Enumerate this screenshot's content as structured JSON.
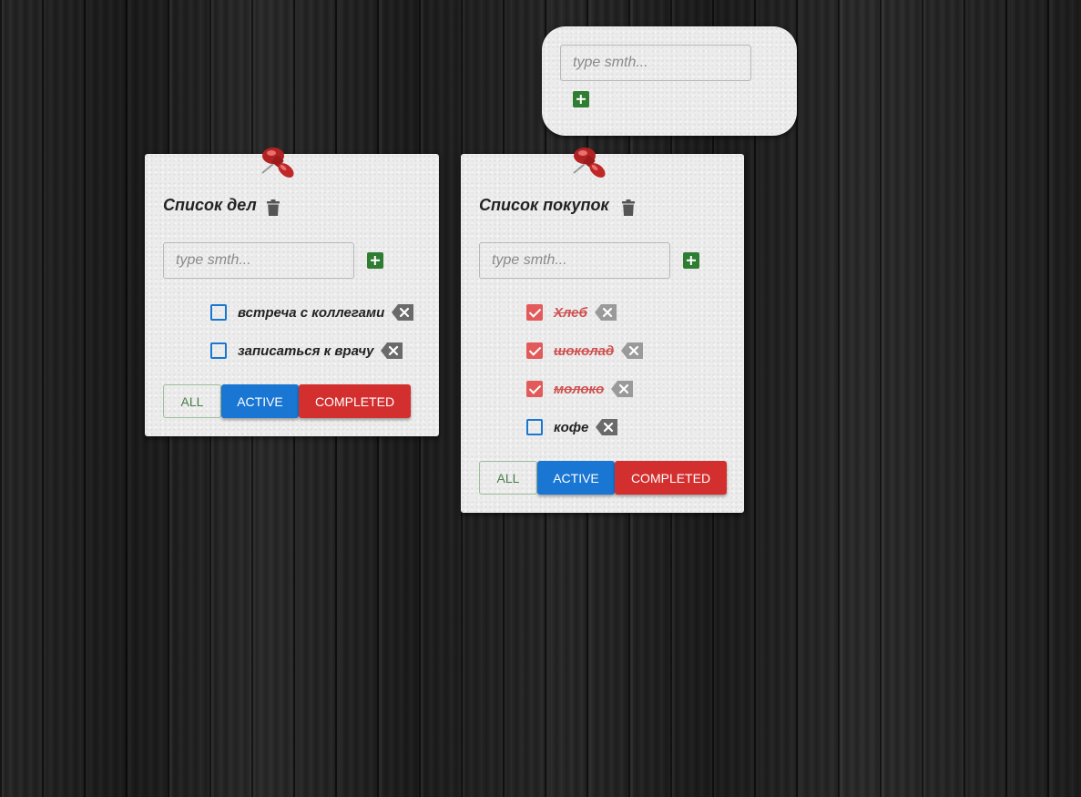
{
  "colors": {
    "board": "#1e1e1e",
    "paper": "#ececec",
    "add": "#2e7d32",
    "checkbox": "#1976d2",
    "checked": "#e25a5a",
    "all_button": "#4a7d4a",
    "active_button": "#1976d2",
    "completed_button": "#d32f2f"
  },
  "new_list": {
    "placeholder": "type smth...",
    "add_icon": "plus-icon"
  },
  "lists": [
    {
      "title": "Список дел",
      "placeholder": "type smth...",
      "items": [
        {
          "text": "встреча с коллегами",
          "done": false
        },
        {
          "text": "записаться к врачу",
          "done": false
        }
      ],
      "filters": {
        "all": "ALL",
        "active": "ACTIVE",
        "completed": "COMPLETED"
      }
    },
    {
      "title": "Список покупок",
      "placeholder": "type smth...",
      "items": [
        {
          "text": "Хлеб",
          "done": true
        },
        {
          "text": "шоколад",
          "done": true
        },
        {
          "text": "молоко",
          "done": true
        },
        {
          "text": "кофе",
          "done": false
        }
      ],
      "filters": {
        "all": "ALL",
        "active": "ACTIVE",
        "completed": "COMPLETED"
      }
    }
  ],
  "icons": {
    "pin": "pushpin-icon",
    "trash": "trash-icon",
    "delete": "backspace-icon",
    "add": "plus-icon"
  }
}
